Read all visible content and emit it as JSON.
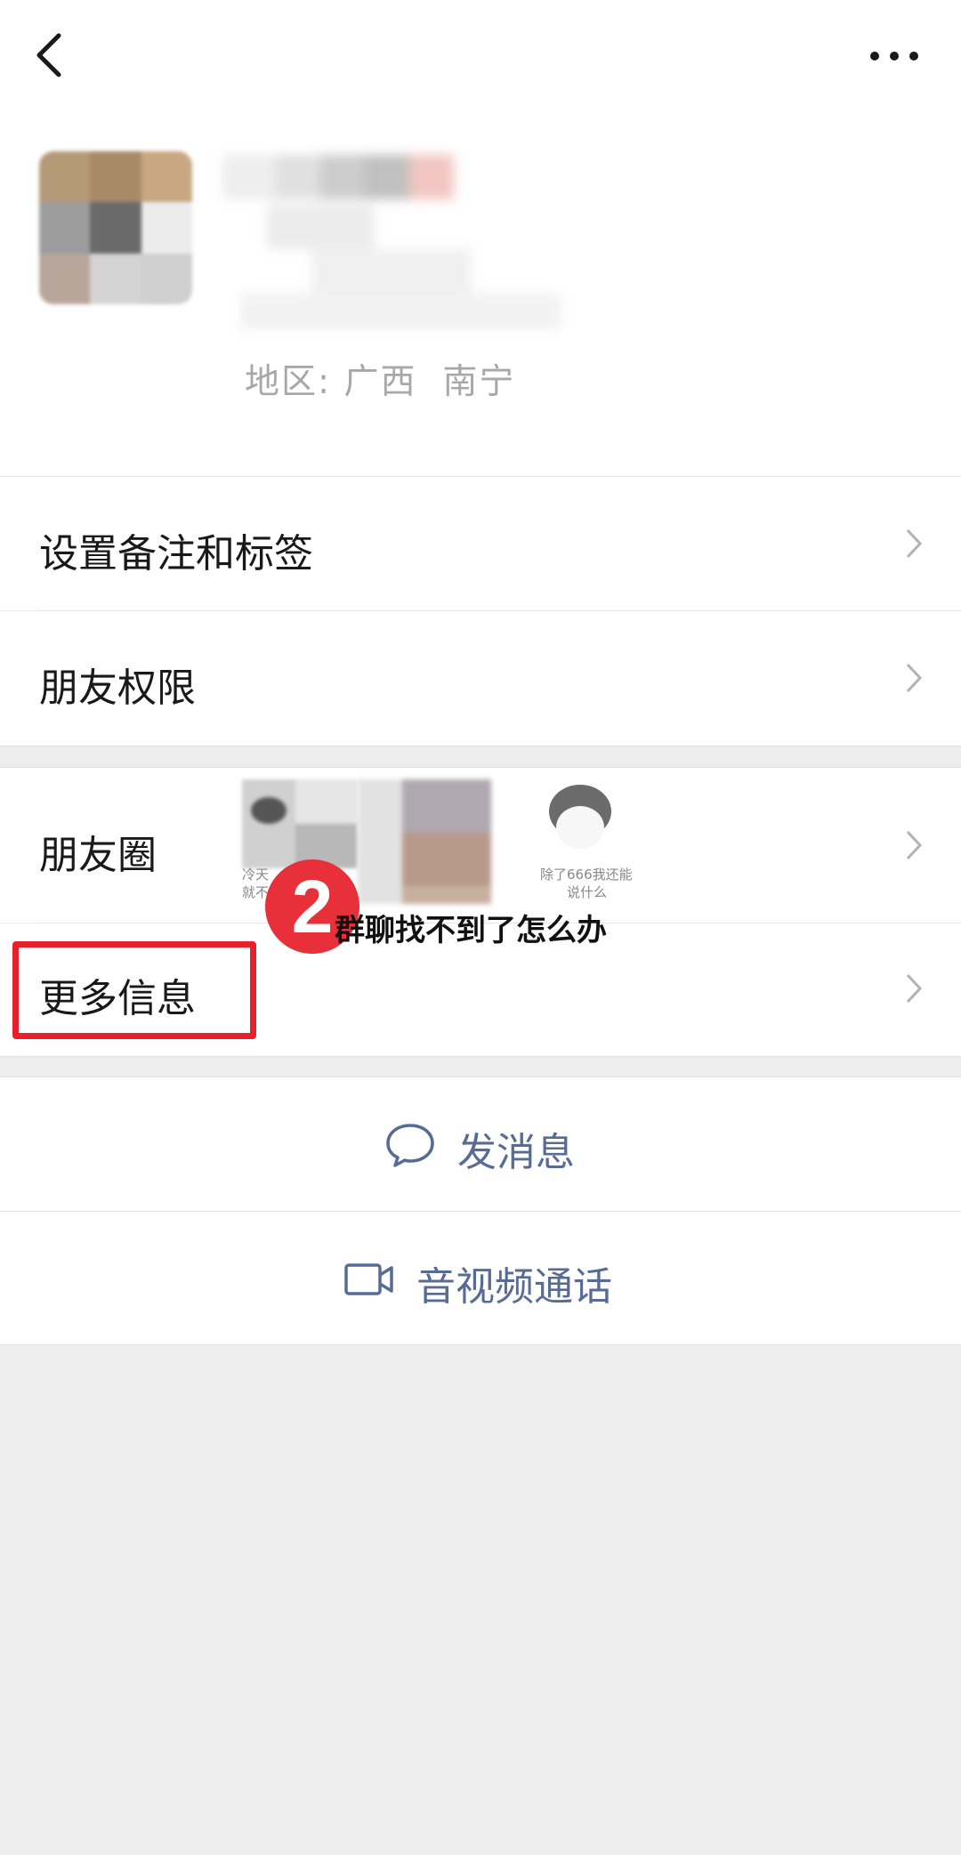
{
  "nav": {
    "back_icon": "chevron-left-icon",
    "more_icon": "ellipsis-icon"
  },
  "profile": {
    "region_label": "地区:",
    "region_value": "广西  南宁"
  },
  "menu": {
    "remark_tags": "设置备注和标签",
    "permissions": "朋友权限",
    "moments": "朋友圈",
    "more_info": "更多信息"
  },
  "moments_thumbs": {
    "caption_1a": "冷天",
    "caption_1b": "就不",
    "caption_3a": "除了666我还能",
    "caption_3b": "说什么"
  },
  "overlay": {
    "step_number": "2",
    "banner_text": "群聊找不到了怎么办",
    "highlight_color": "#e8202a"
  },
  "actions": {
    "message": "发消息",
    "call": "音视频通话"
  },
  "colors": {
    "link": "#576b95",
    "background": "#ededed"
  }
}
